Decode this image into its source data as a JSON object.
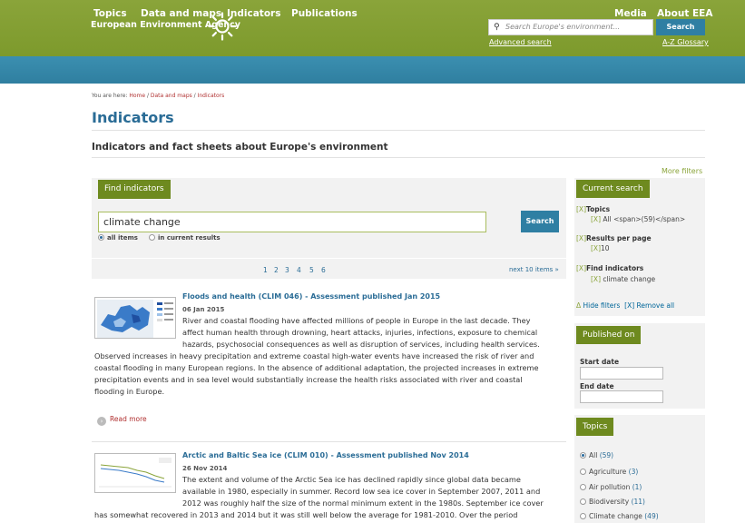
{
  "header": {
    "brand": "European Environment Agency",
    "search_placeholder": "Search Europe's environment...",
    "search_button": "Search",
    "advanced_search": "Advanced search",
    "glossary": "A-Z Glossary"
  },
  "nav": {
    "items": [
      "Topics",
      "Data and maps",
      "Indicators",
      "Publications"
    ],
    "right_items": [
      "Media",
      "About EEA"
    ]
  },
  "breadcrumb": {
    "prefix": "You are here: ",
    "home": "Home",
    "sep1": " / ",
    "data_maps": "Data and maps",
    "sep2": " / ",
    "current": "Indicators"
  },
  "page": {
    "title": "Indicators",
    "subtitle": "Indicators and fact sheets about Europe's environment",
    "more_filters": "More filters"
  },
  "find": {
    "tab_label": "Find indicators",
    "input_value": "climate change",
    "button": "Search",
    "radio_all": "all items",
    "radio_current": "in current results"
  },
  "pager": {
    "pages": [
      "1",
      "2",
      "3",
      "4",
      "5",
      "6"
    ],
    "next": "next 10 items »"
  },
  "results": [
    {
      "title": "Floods and health (CLIM 046) - Assessment published Jan 2015",
      "date": "06 Jan 2015",
      "text_lines": [
        "River and coastal flooding have affected millions of people in Europe in the last decade. They",
        "affect human health through drowning, heart attacks, injuries, infections, exposure to chemical",
        "hazards, psychosocial consequences as well as disruption of services, including health services.",
        "Observed increases in heavy precipitation and extreme coastal high-water events have increased the risk of river and",
        "coastal flooding in many European regions. In the absence of additional adaptation, the projected increases in extreme",
        "precipitation events and in sea level would substantially increase the health risks associated with river and coastal",
        "flooding in Europe."
      ],
      "read_more": "Read more"
    },
    {
      "title": "Arctic and Baltic Sea ice (CLIM 010) - Assessment published Nov 2014",
      "date": "26 Nov 2014",
      "text_lines": [
        "The extent and volume of the Arctic Sea ice has declined rapidly since global data became",
        "available in 1980, especially in summer. Record low sea ice cover in September 2007, 2011 and",
        "2012 was roughly half the size of the normal minimum extent in the 1980s. September ice cover",
        "has somewhat recovered in 2013 and 2014 but it was still well below the average for 1981-2010.  Over the period"
      ]
    }
  ],
  "sidebar": {
    "current_search_label": "Current search",
    "x": "[X]",
    "topics_label": "Topics",
    "topics_value": "All <span>(59)</span>",
    "results_per_page_label": "Results per page",
    "results_per_page_value": "10",
    "find_indicators_label": "Find indicators",
    "find_indicators_value": "climate change",
    "hide_filters": "Hide filters",
    "remove_all": "Remove all",
    "published_on_label": "Published on",
    "start_date": "Start date",
    "end_date": "End date",
    "topics_box_label": "Topics",
    "topics_list": [
      {
        "name": "All",
        "count": "(59)"
      },
      {
        "name": "Agriculture",
        "count": "(3)"
      },
      {
        "name": "Air pollution",
        "count": "(1)"
      },
      {
        "name": "Biodiversity",
        "count": "(11)"
      },
      {
        "name": "Climate change",
        "count": "(49)"
      }
    ]
  },
  "colors": {
    "header_green": "#7d9a2c",
    "nav_blue": "#2f7fa0",
    "tab_green": "#6e8a1f",
    "link_blue": "#2a6c96"
  }
}
